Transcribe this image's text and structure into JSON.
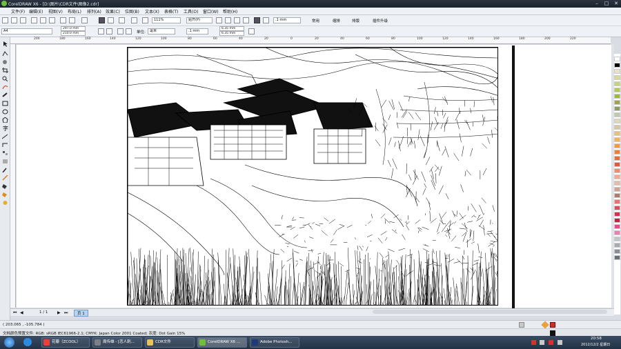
{
  "window": {
    "title": "CorelDRAW X6 - [D:\\图片\\CDR文件\\图像2.cdr]",
    "controls": [
      "–",
      "□",
      "✕"
    ]
  },
  "menu": [
    {
      "label": "文件(F)"
    },
    {
      "label": "编辑(E)"
    },
    {
      "label": "视图(V)"
    },
    {
      "label": "布局(L)"
    },
    {
      "label": "排列(A)"
    },
    {
      "label": "效果(C)"
    },
    {
      "label": "位图(B)"
    },
    {
      "label": "文本(X)"
    },
    {
      "label": "表格(T)"
    },
    {
      "label": "工具(O)"
    },
    {
      "label": "窗口(W)"
    },
    {
      "label": "帮助(H)"
    }
  ],
  "toolbar1": {
    "zoom": "111%",
    "snap": "贴齐(P)",
    "nudge": ".1 mm",
    "workspace_labels": [
      "常用",
      "缩排",
      "排版",
      "插件升级"
    ]
  },
  "toolbar2": {
    "page_size": "A4",
    "width": "297.0 mm",
    "height": "210.0 mm",
    "units_label": "单位:",
    "units_value": "毫米",
    "nudge2": ".1 mm",
    "dup_x": "6.35 mm",
    "dup_y": "6.35 mm"
  },
  "hruler": {
    "ticks": [
      "200",
      "180",
      "160",
      "140",
      "120",
      "100",
      "80",
      "60",
      "40",
      "20",
      "0",
      "20",
      "40",
      "60",
      "80",
      "100",
      "120",
      "140",
      "160",
      "180",
      "200",
      "220"
    ]
  },
  "pagenav": {
    "counter": "1 / 1",
    "page_tab": "页 1"
  },
  "status": {
    "coords": "( 203.065 , -105.784 )",
    "profile": "文档颜色预置文件: RGB: sRGB IEC61966-2.1; CMYK: Japan Color 2001 Coated; 灰度: Dot Gain 15%"
  },
  "taskbar": {
    "tasks": [
      {
        "label": "花瓣（ZCOOL）",
        "color": "#e0453a"
      },
      {
        "label": "周传雄 - [恋人刺...",
        "color": "#7a7f88"
      },
      {
        "label": "CDR文件",
        "color": "#e8c25a"
      },
      {
        "label": "CorelDRAW X6 ...",
        "color": "#6fbf3a"
      },
      {
        "label": "Adobe Photosh...",
        "color": "#1f3a7a"
      }
    ],
    "time": "20:58",
    "date": "2012/12/2 星期日"
  },
  "palette_colors": [
    "#ffffff",
    "#000000",
    "#e9e3c8",
    "#dcd89a",
    "#c9d37a",
    "#b5c95a",
    "#9dbb3b",
    "#a4a24d",
    "#8c9f5a",
    "#c3c9a8",
    "#e0d9b8",
    "#d8c79e",
    "#e8c07a",
    "#f1b35b",
    "#f39a3c",
    "#f07f2f",
    "#e86c33",
    "#e05a3a",
    "#f18b6c",
    "#f4a98f",
    "#e8bba8",
    "#cfa294",
    "#b07a6a",
    "#f06e6e",
    "#e24b5a",
    "#d6304a",
    "#c12340",
    "#e54d8a",
    "#f07db0",
    "#c2c4c8",
    "#a8aaaf",
    "#8a8d93",
    "#6b6f76"
  ]
}
